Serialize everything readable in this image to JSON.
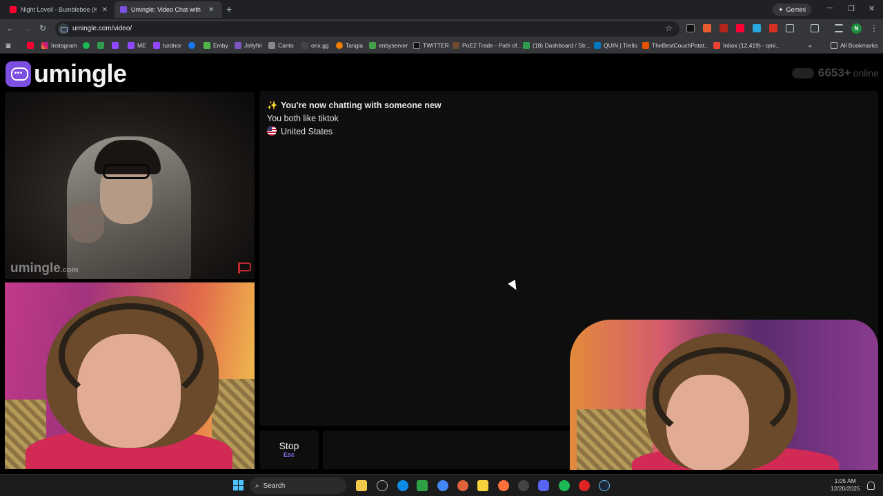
{
  "browser": {
    "tabs": [
      {
        "title": "Night Lovell - Bumblebee (KEIF",
        "active": false
      },
      {
        "title": "Umingle: Video Chat with S",
        "active": true
      }
    ],
    "new_tab": "+",
    "gemini_label": "Gemini",
    "url": "umingle.com/video/",
    "profile_initial": "N",
    "bookmarks": [
      "Instagram",
      "ME",
      "turdnor",
      "Emby",
      "Jellyfin",
      "Canto",
      "onx.gg",
      "Tangia",
      "enbyserver",
      "TWITTER",
      "PoE2 Trade - Path of...",
      "(18) Dashboard / Str...",
      "QUIN | Trello",
      "TheBestCouchPotat...",
      "Inbox (12,419) - qmi..."
    ],
    "all_bookmarks": "All Bookmarks"
  },
  "site": {
    "logo_text": "umingle",
    "online_count": "6653+",
    "online_label": "online"
  },
  "stranger_video": {
    "watermark": "umingle",
    "watermark_suffix": ".com"
  },
  "chat": {
    "messages": [
      {
        "icon": "sparkles-icon",
        "text": "You're now chatting with someone new"
      },
      {
        "text": "You both like tiktok"
      },
      {
        "icon": "us-flag-icon",
        "text": "United States"
      }
    ]
  },
  "controls": {
    "stop_label": "Stop",
    "stop_hint": "Esc",
    "message_placeholder": ""
  },
  "taskbar": {
    "search_label": "Search",
    "time": "1:05 AM",
    "date": "12/20/2025"
  },
  "colors": {
    "brand": "#7b4fe0",
    "report": "#c0282d"
  }
}
